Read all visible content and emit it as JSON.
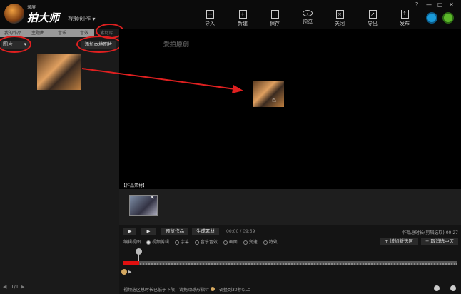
{
  "header": {
    "brand_small": "录屏",
    "brand": "拍大师",
    "mode": "视频创作 ▾",
    "toolbar": [
      "导入",
      "新建",
      "保存",
      "预览",
      "关闭",
      "导出",
      "发布"
    ],
    "window_controls": [
      "?",
      "—",
      "□",
      "✕"
    ]
  },
  "left": {
    "tabs": [
      "我的作品",
      "主题曲",
      "音乐",
      "音效",
      "素材库"
    ],
    "category": "图片",
    "add_button": "添加本地图片",
    "pager": "1/1"
  },
  "preview": {
    "watermark": "爱拍原创"
  },
  "materials": {
    "label": "【作品素材】"
  },
  "controls": {
    "play": "▶",
    "step": "|▶|",
    "preview_btn": "预览作品",
    "generate_btn": "生成素材",
    "time": "00:00 / 09:59",
    "total": "作品总时长(剪辑选取):00:27",
    "edit_view_label": "编辑视图",
    "views": [
      "视频剪辑",
      "字幕",
      "音乐音效",
      "画面",
      "变速",
      "特效"
    ],
    "add_region": "+ 增加新选区",
    "cancel_region": "− 取消选中区"
  },
  "status": {
    "message": "视频选区总时长已低于下限，请拖动球形指针",
    "message2": "，调整到30秒以上"
  },
  "colors": {
    "accent": "#e02020"
  }
}
